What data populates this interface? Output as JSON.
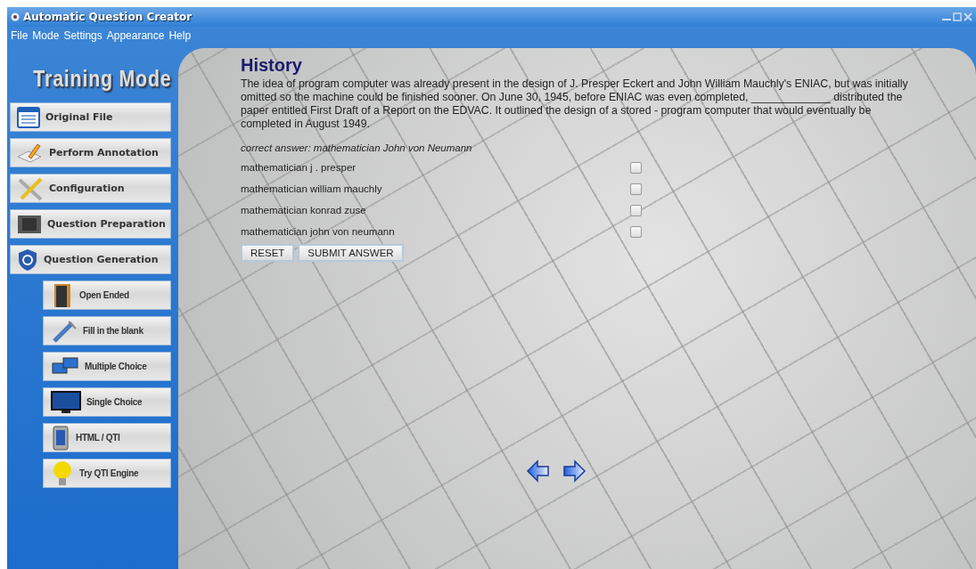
{
  "window": {
    "title": "Automatic Question Creator"
  },
  "menu": [
    "File",
    "Mode",
    "Settings",
    "Appearance",
    "Help"
  ],
  "sidebar": {
    "heading": "Training Mode",
    "items": [
      {
        "label": "Original File",
        "kind": "main"
      },
      {
        "label": "Perform Annotation",
        "kind": "main"
      },
      {
        "label": "Configuration",
        "kind": "main"
      },
      {
        "label": "Question Preparation",
        "kind": "main"
      },
      {
        "label": "Question Generation",
        "kind": "main"
      },
      {
        "label": "Open Ended",
        "kind": "sub"
      },
      {
        "label": "Fill in the blank",
        "kind": "sub"
      },
      {
        "label": "Multiple Choice",
        "kind": "sub"
      },
      {
        "label": "Single Choice",
        "kind": "sub"
      },
      {
        "label": "HTML / QTI",
        "kind": "sub"
      },
      {
        "label": "Try QTI Engine",
        "kind": "sub"
      }
    ]
  },
  "question": {
    "title": "History",
    "text": "The idea of program computer was already present in the design of J. Presper Eckert and John William Mauchly's ENIAC, but was initially omitted so the machine could be finished sooner. On June 30, 1945, before ENIAC was even completed, _____________ distributed the paper entitled First Draft of a Report on the EDVAC. It outlined the design of a stored - program computer that would eventually be completed in August 1949.",
    "correct_answer": "correct answer: mathematician John von Neumann",
    "options": [
      {
        "label": "mathematician j . presper",
        "checked": false
      },
      {
        "label": "mathematician william mauchly",
        "checked": false
      },
      {
        "label": "mathematician konrad zuse",
        "checked": false
      },
      {
        "label": "mathematician john von neumann",
        "checked": false
      }
    ],
    "buttons": [
      "RESET",
      "SUBMIT ANSWER"
    ]
  }
}
